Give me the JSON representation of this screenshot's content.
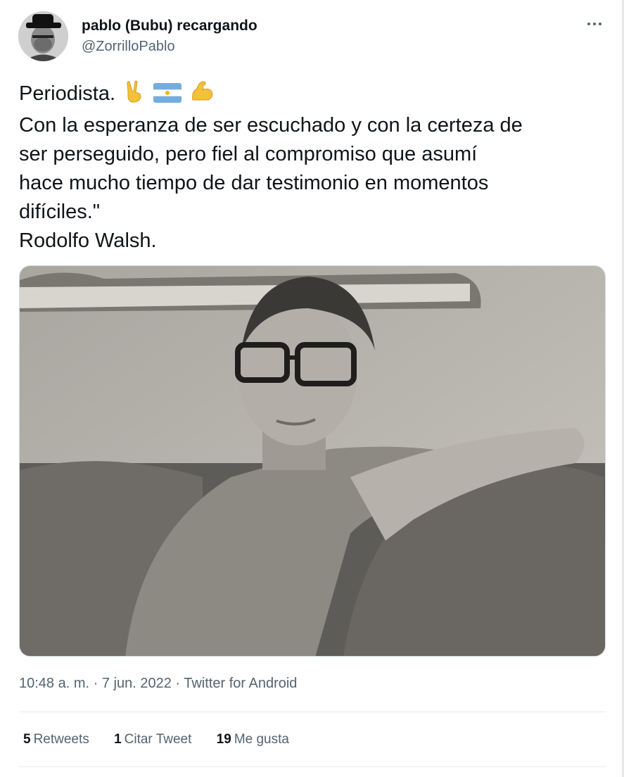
{
  "author": {
    "display_name": "pablo (Bubu) recargando",
    "handle": "@ZorrilloPablo"
  },
  "more_icon": "more-horizontal-icon",
  "tweet": {
    "line1": "Periodista.",
    "line1_emojis": [
      "victory-hand-icon",
      "argentina-flag-icon",
      "flexed-biceps-icon"
    ],
    "line2": "Con la esperanza de ser escuchado y con la certeza de",
    "line3": "ser perseguido, pero fiel al compromiso que asumí",
    "line4": "hace mucho tiempo de dar testimonio en momentos",
    "line5": "difíciles.\"",
    "line6": "Rodolfo Walsh."
  },
  "meta": {
    "time": "10:48 a. m.",
    "sep1": " · ",
    "date": "7 jun. 2022",
    "sep2": " · ",
    "source": "Twitter for Android"
  },
  "stats": {
    "retweets_count": "5",
    "retweets_label": "Retweets",
    "quotes_count": "1",
    "quotes_label": "Citar Tweet",
    "likes_count": "19",
    "likes_label": "Me gusta"
  },
  "colors": {
    "text": "#0f1419",
    "secondary": "#536471",
    "divider": "#e6ecf0"
  }
}
